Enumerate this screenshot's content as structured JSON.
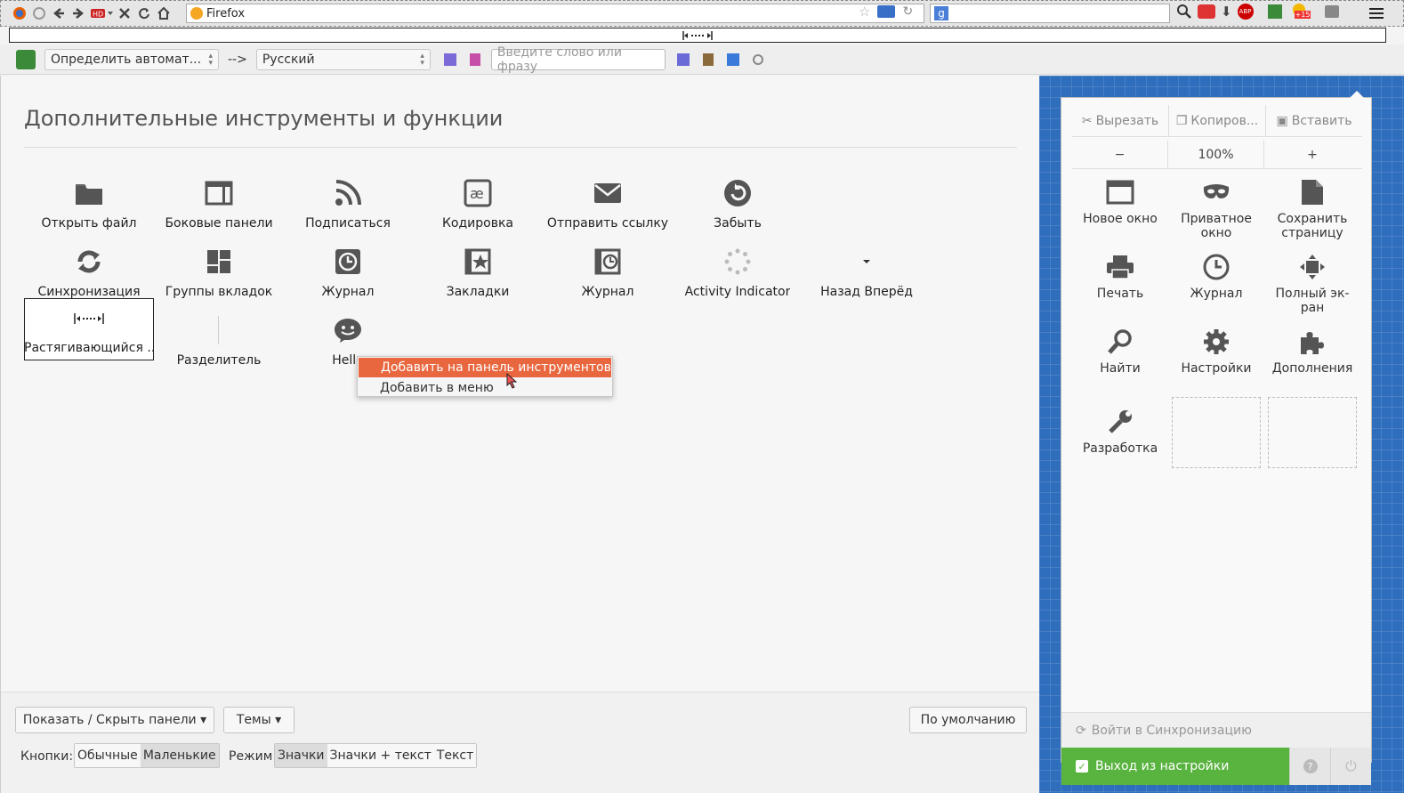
{
  "browser": {
    "url_text": "Firefox",
    "ext_badge": "+15"
  },
  "translator": {
    "source_lang": "Определить автомат...",
    "arrow": "-->",
    "target_lang": "Русский",
    "input_placeholder": "Введите слово или фразу"
  },
  "customize": {
    "title": "Дополнительные инструменты и функции",
    "items": [
      {
        "label": "Открыть файл",
        "icon": "folder-icon"
      },
      {
        "label": "Боковые панели",
        "icon": "sidebar-icon"
      },
      {
        "label": "Подписаться",
        "icon": "rss-icon"
      },
      {
        "label": "Кодировка",
        "icon": "encoding-icon"
      },
      {
        "label": "Отправить ссылку",
        "icon": "email-icon"
      },
      {
        "label": "Забыть",
        "icon": "forget-icon"
      },
      {
        "label": "Синхронизация",
        "icon": "sync-icon"
      },
      {
        "label": "Группы вкладок",
        "icon": "tab-groups-icon"
      },
      {
        "label": "Журнал",
        "icon": "history-icon"
      },
      {
        "label": "Закладки",
        "icon": "bookmarks-icon"
      },
      {
        "label": "Журнал",
        "icon": "history-panel-icon"
      },
      {
        "label": "Activity Indicator",
        "icon": "throbber-icon"
      },
      {
        "label": "Назад Вперёд",
        "icon": "dropdown-arrow-icon"
      },
      {
        "label": "Растягивающийся ...",
        "icon": "flexible-space-icon"
      },
      {
        "label": "Разделитель",
        "icon": "separator-icon"
      },
      {
        "label": "Hello",
        "icon": "hello-icon"
      }
    ]
  },
  "context_menu": {
    "add_toolbar": "Добавить на панель инструментов",
    "add_menu": "Добавить в меню"
  },
  "bottom": {
    "show_hide": "Показать / Скрыть панели ▾",
    "themes": "Темы ▾",
    "defaults": "По умолчанию",
    "buttons_label": "Кнопки:",
    "btn_normal": "Обычные",
    "btn_small": "Маленькие",
    "mode_label": "Режим",
    "mode_icons": "Значки",
    "mode_icons_text": "Значки + текст",
    "mode_text": "Текст"
  },
  "menu_panel": {
    "cut": "Вырезать",
    "copy": "Копиров...",
    "paste": "Вставить",
    "zoom_out": "−",
    "zoom": "100%",
    "zoom_in": "+",
    "items": [
      {
        "label": "Новое окно",
        "icon": "new-window-icon"
      },
      {
        "label": "Приватное окно",
        "icon": "private-mask-icon"
      },
      {
        "label": "Сохранить страницу",
        "icon": "save-page-icon"
      },
      {
        "label": "Печать",
        "icon": "print-icon"
      },
      {
        "label": "Журнал",
        "icon": "history-clock-icon"
      },
      {
        "label": "Полный эк-ран",
        "icon": "fullscreen-icon"
      },
      {
        "label": "Найти",
        "icon": "find-icon"
      },
      {
        "label": "Настройки",
        "icon": "settings-gear-icon"
      },
      {
        "label": "Дополнения",
        "icon": "addons-puzzle-icon"
      },
      {
        "label": "Разработка",
        "icon": "developer-wrench-icon"
      }
    ],
    "sync": "Войти в Синхронизацию",
    "exit": "Выход из настройки"
  }
}
